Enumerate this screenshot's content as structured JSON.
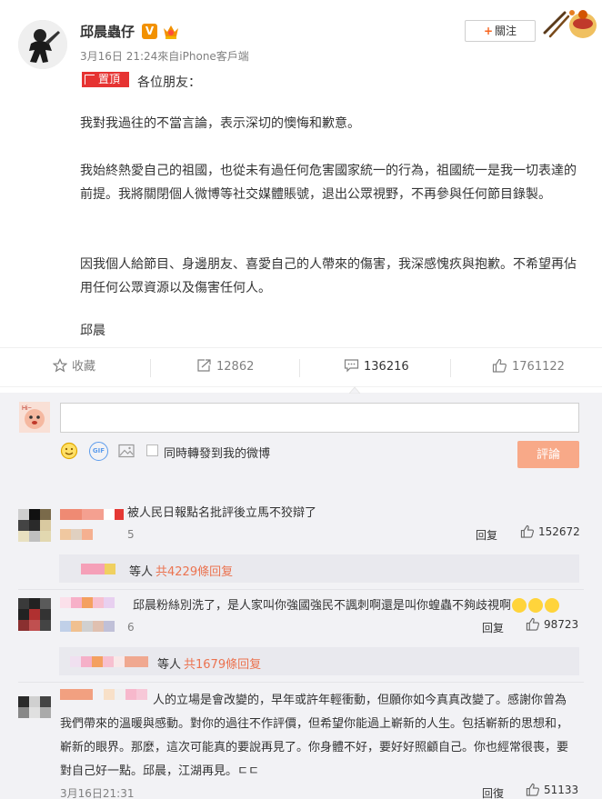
{
  "post": {
    "author": "邱晨蟲仔",
    "verified_mark": "V",
    "meta": "3月16日 21:24來自iPhone客戶端",
    "follow_label": "關注",
    "pin_label": "置頂",
    "greeting": "各位朋友：",
    "paragraphs": [
      "我對我過往的不當言論，表示深切的懊悔和歉意。",
      "我始終熱愛自己的祖國，也從未有過任何危害國家統一的行為，祖國統一是我一切表達的前提。我將關閉個人微博等社交媒體賬號，退出公眾視野，不再參與任何節目錄製。",
      "因我個人給節目、身邊朋友、喜愛自己的人帶來的傷害，我深感愧疚與抱歉。不希望再佔用任何公眾資源以及傷害任何人。",
      "邱晨"
    ]
  },
  "actions": {
    "favorite": "收藏",
    "repost": "12862",
    "comment": "136216",
    "like": "1761122"
  },
  "compose": {
    "input_value": "",
    "repost_label": "同時轉發到我的微博",
    "submit_label": "評論",
    "gif_label": "GIF"
  },
  "comments": [
    {
      "text": "被人民日報點名批評後立馬不狡辯了",
      "count": "5",
      "reply_label": "回复",
      "likes": "152672",
      "sub": {
        "suffix": "等人",
        "count": "共4229條回复"
      }
    },
    {
      "text": "邱晨粉絲別洗了，是人家叫你強國強民不諷刺啊還是叫你蝗蟲不夠歧視啊",
      "count": "6",
      "reply_label": "回复",
      "likes": "98723",
      "sub": {
        "suffix": "等人",
        "count": "共1679條回复"
      }
    },
    {
      "text_lines": [
        "人的立場是會改變的，早年或許年輕衝動，但願你如今真真改變了。感謝你曾為",
        "我們帶來的溫暖與感動。對你的過往不作評價，但希望你能過上嶄新的人生。包括嶄新的思想和，",
        "嶄新的眼界。那麼，這次可能真的要說再見了。你身體不好，要好好照顧自己。你也經常很喪，要",
        "對自己好一點。邱晨，江湖再見。ㄷㄷ"
      ],
      "date": "3月16日21:31",
      "reply_label": "回復",
      "likes": "51133"
    }
  ],
  "colors": {
    "accent": "#eb7350",
    "pin": "#e63332",
    "badge": "#f29100",
    "submit": "#f8a988",
    "panel": "#f2f2f5"
  },
  "icons": {
    "favorite": "star-icon",
    "repost": "share-icon",
    "comment": "comment-icon",
    "like": "thumbs-up-icon"
  }
}
